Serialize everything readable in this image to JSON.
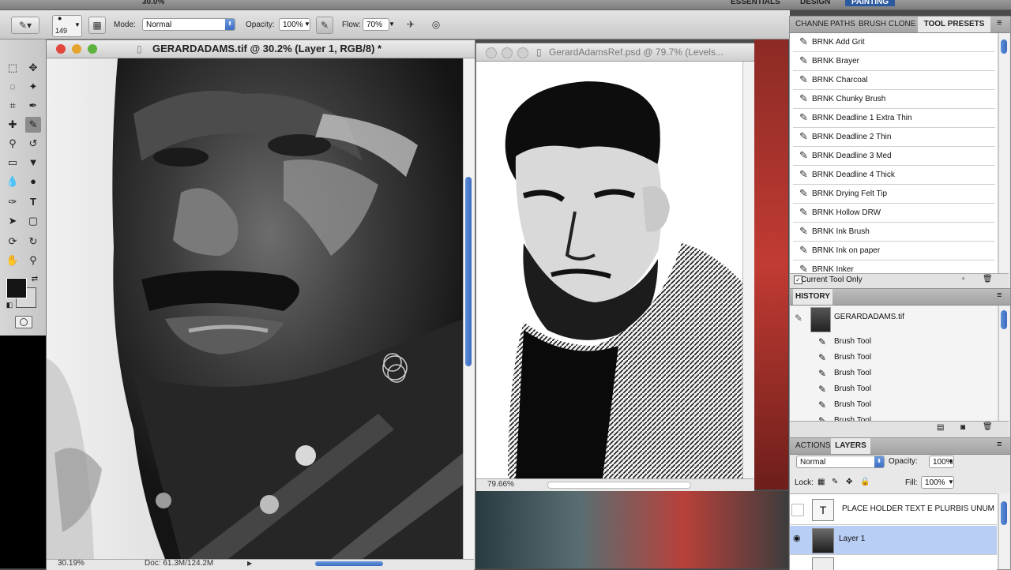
{
  "topbar": {
    "zoom_fragment": "30.0%",
    "workspaces": [
      "ESSENTIALS",
      "DESIGN",
      "PAINTING"
    ]
  },
  "options": {
    "brush_size": "149",
    "mode_label": "Mode:",
    "mode_value": "Normal",
    "opacity_label": "Opacity:",
    "opacity_value": "100%",
    "flow_label": "Flow:",
    "flow_value": "70%"
  },
  "doc1": {
    "title": "GERARDADAMS.tif @ 30.2% (Layer 1, RGB/8) *",
    "zoom": "30.19%",
    "doc_info": "Doc: 61.3M/124.2M"
  },
  "doc2": {
    "title": "GerardAdamsRef.psd @ 79.7% (Levels...",
    "zoom": "79.66%"
  },
  "presets": {
    "tabs": [
      "CHANNE",
      "PATHS",
      "BRUSH",
      "CLONE S",
      "TOOL PRESETS"
    ],
    "items": [
      "BRNK Add Grit",
      "BRNK Brayer",
      "BRNK Charcoal",
      "BRNK Chunky Brush",
      "BRNK Deadline 1 Extra Thin",
      "BRNK Deadline 2 Thin",
      "BRNK Deadline 3 Med",
      "BRNK Deadline 4 Thick",
      "BRNK Drying Felt Tip",
      "BRNK Hollow DRW",
      "BRNK Ink Brush",
      "BRNK Ink on paper",
      "BRNK Inker"
    ],
    "current_tool_only": "Current Tool Only"
  },
  "history": {
    "tab": "HISTORY",
    "snapshot": "GERARDADAMS.tif",
    "steps": [
      "Brush Tool",
      "Brush Tool",
      "Brush Tool",
      "Brush Tool",
      "Brush Tool",
      "Brush Tool"
    ]
  },
  "layers": {
    "tabs": [
      "ACTIONS",
      "LAYERS"
    ],
    "blend_mode": "Normal",
    "opacity_label": "Opacity:",
    "opacity_value": "100%",
    "lock_label": "Lock:",
    "fill_label": "Fill:",
    "fill_value": "100%",
    "items": [
      {
        "name": "PLACE HOLDER TEXT E PLURBIS UNUM - ...",
        "kind": "text"
      },
      {
        "name": "Layer 1",
        "kind": "image"
      }
    ]
  },
  "colors": {
    "selection_blue": "#b9cef5",
    "accent_blue": "#3a6bbf"
  }
}
